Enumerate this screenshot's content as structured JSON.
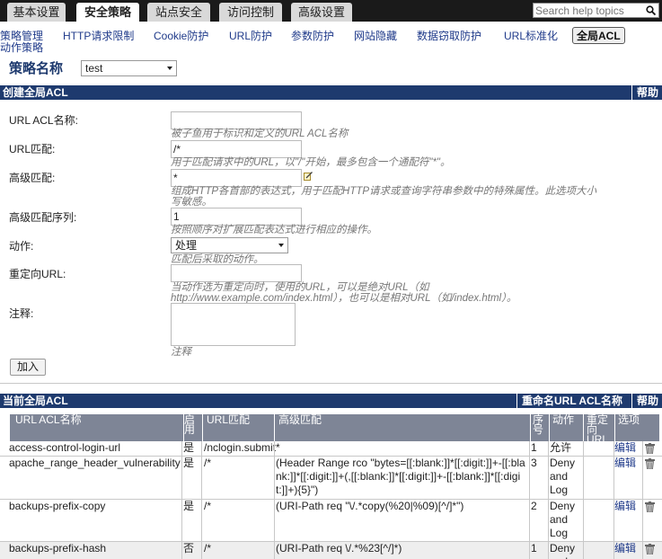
{
  "tabs": [
    "基本设置",
    "安全策略",
    "站点安全",
    "访问控制",
    "高级设置"
  ],
  "search": {
    "placeholder": "Search help topics"
  },
  "subnav": [
    "策略管理",
    "HTTP请求限制",
    "Cookie防护",
    "URL防护",
    "参数防护",
    "网站隐藏",
    "数据窃取防护",
    "URL标准化",
    "全局ACL"
  ],
  "subnav_second": "动作策略",
  "policy": {
    "label": "策略名称",
    "value": "test"
  },
  "create_section": {
    "title": "创建全局ACL",
    "help": "帮助"
  },
  "form": {
    "acl_name": {
      "label": "URL ACL名称:",
      "value": "",
      "hint": "被子鱼用于标识和定义的URL ACL名称"
    },
    "url_match": {
      "label": "URL匹配:",
      "value": "/*",
      "hint": "用于匹配请求中的URL，以\"/\"开始，最多包含一个通配符\"*\"。"
    },
    "adv_match": {
      "label": "高级匹配:",
      "value": "*",
      "hint1": "组成HTTP各首部的表达式，用于匹配HTTP请求或查询字符串参数中的特殊属性。此选项大小",
      "hint2": "写敏感。"
    },
    "adv_seq": {
      "label": "高级匹配序列:",
      "value": "1",
      "hint": "按照顺序对扩展匹配表达式进行相应的操作。"
    },
    "action": {
      "label": "动作:",
      "value": "处理",
      "hint": "匹配后采取的动作。"
    },
    "redirect": {
      "label": "重定向URL:",
      "value": "",
      "hint1": "当动作选为重定向时，使用的URL，可以是绝对URL（如",
      "hint2": "http://www.example.com/index.html），也可以是相对URL（如/index.html）。"
    },
    "comment": {
      "label": "注释:",
      "hint": "注释"
    },
    "add_button": "加入"
  },
  "current_section": {
    "title": "当前全局ACL",
    "rename": "重命名URL ACL名称",
    "help": "帮助"
  },
  "table": {
    "headers": {
      "name": "URL ACL名称",
      "enabled": "启用",
      "url": "URL匹配",
      "adv": "高级匹配",
      "seq": "序号",
      "action": "动作",
      "redirect": "重定向URL",
      "options": "选项"
    },
    "rows": [
      {
        "name": "access-control-login-url",
        "enabled": "是",
        "url": "/nclogin.submit",
        "adv": "*",
        "seq": "1",
        "action": "允许",
        "edit": "编辑"
      },
      {
        "name": "apache_range_header_vulnerability",
        "enabled": "是",
        "url": "/*",
        "adv": "(Header Range rco \"bytes=[[:blank:]]*[[:digit:]]+-[[:blank:]]*[[:digit:]]+(,[[:blank:]]*[[:digit:]]+-[[:blank:]]*[[:digit:]]+){5}\")",
        "seq": "3",
        "action": "Deny and Log",
        "edit": "编辑"
      },
      {
        "name": "backups-prefix-copy",
        "enabled": "是",
        "url": "/*",
        "adv": "(URI-Path req \"\\/.*copy(%20|%09)[^/]*\")",
        "seq": "2",
        "action": "Deny and Log",
        "edit": "编辑"
      },
      {
        "name": "backups-prefix-hash",
        "enabled": "否",
        "url": "/*",
        "adv": "(URI-Path req \\/.*%23[^/]*)",
        "seq": "1",
        "action": "Deny and Log",
        "edit": "编辑"
      }
    ]
  }
}
